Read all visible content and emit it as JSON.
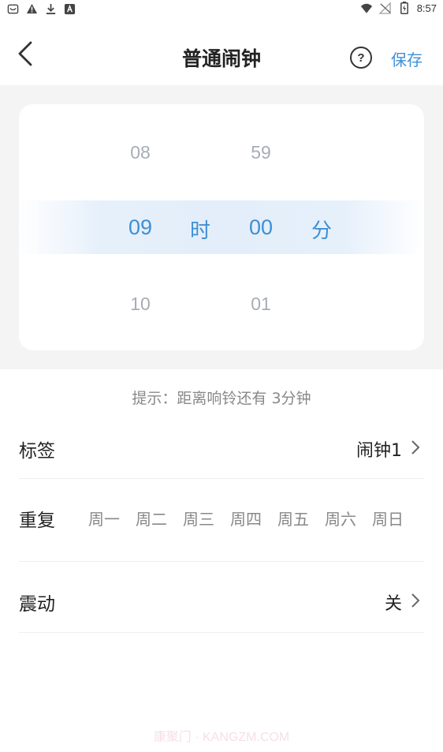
{
  "status_bar": {
    "time": "8:57",
    "left_icons": [
      "mail-icon",
      "warning-icon",
      "download-icon",
      "app-icon"
    ],
    "right_icons": [
      "wifi-icon",
      "no-signal-icon",
      "battery-icon"
    ]
  },
  "header": {
    "title": "普通闹钟",
    "help_label": "?",
    "save_label": "保存"
  },
  "picker": {
    "hour": {
      "prev": "08",
      "selected": "09",
      "next": "10",
      "unit": "时"
    },
    "minute": {
      "prev": "59",
      "selected": "00",
      "next": "01",
      "unit": "分"
    }
  },
  "hint": "提示：距离响铃还有 3分钟",
  "rows": {
    "label": {
      "title": "标签",
      "value": "闹钟1"
    },
    "repeat": {
      "title": "重复",
      "days": [
        "周一",
        "周二",
        "周三",
        "周四",
        "周五",
        "周六",
        "周日"
      ]
    },
    "vibrate": {
      "title": "震动",
      "value": "关"
    }
  },
  "watermark": "康聚门 · KANGZM.COM",
  "colors": {
    "accent": "#3d8fd4",
    "background_gray": "#f4f4f4",
    "dim_text": "#a7adb6"
  }
}
